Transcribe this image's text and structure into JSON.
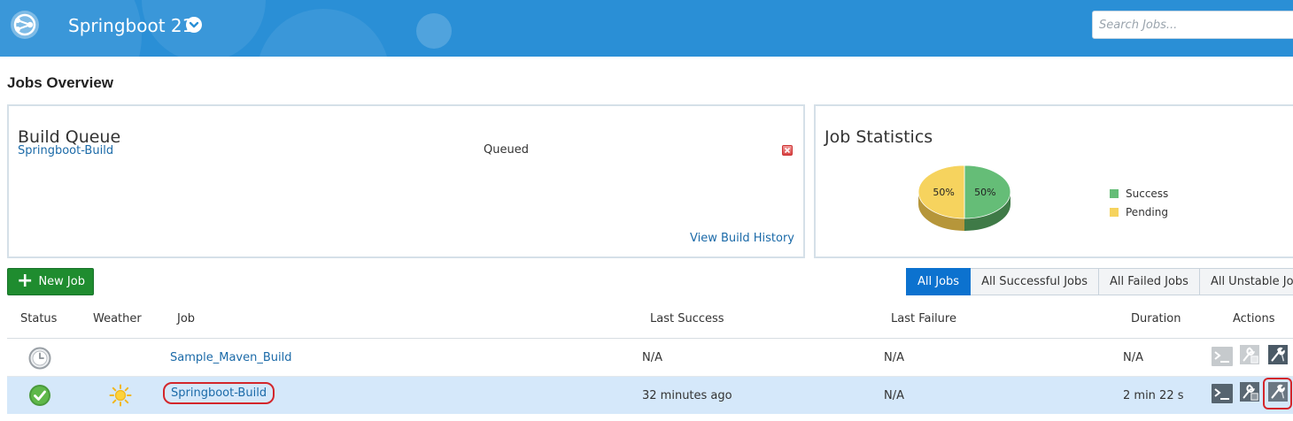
{
  "header": {
    "project_name": "Springboot 21",
    "search_placeholder": "Search Jobs..."
  },
  "page": {
    "title": "Jobs Overview"
  },
  "build_queue": {
    "title": "Build Queue",
    "job": "Springboot-Build",
    "status": "Queued",
    "history_link": "View Build History"
  },
  "job_statistics": {
    "title": "Job Statistics",
    "chart_data": {
      "type": "pie",
      "categories": [
        "Success",
        "Pending"
      ],
      "values": [
        50,
        50
      ],
      "data_labels": [
        "50%",
        "50%"
      ],
      "legend_position": "right",
      "colors": [
        "#65bd77",
        "#f6d35e"
      ]
    }
  },
  "toolbar": {
    "new_job_label": "New Job",
    "filters": [
      {
        "label": "All Jobs",
        "active": true
      },
      {
        "label": "All Successful Jobs",
        "active": false
      },
      {
        "label": "All Failed Jobs",
        "active": false
      },
      {
        "label": "All Unstable Jobs",
        "active": false
      }
    ]
  },
  "table": {
    "columns": [
      "Status",
      "Weather",
      "Job",
      "Last Success",
      "Last Failure",
      "Duration",
      "Actions"
    ],
    "rows": [
      {
        "status_icon": "clock-icon",
        "weather_icon": "",
        "job": "Sample_Maven_Build",
        "last_success": "N/A",
        "last_failure": "N/A",
        "duration": "N/A"
      },
      {
        "status_icon": "success-check-icon",
        "weather_icon": "sun-icon",
        "job": "Springboot-Build",
        "last_success": "32 minutes ago",
        "last_failure": "N/A",
        "duration": "2 min 22 s"
      }
    ]
  },
  "colors": {
    "header_bg": "#2a8fd6",
    "link": "#1b6aa8",
    "primary": "#0c72cf",
    "new_job": "#1f8c2f",
    "highlight_row": "#d5e8fa",
    "annotation": "#d3262b"
  }
}
